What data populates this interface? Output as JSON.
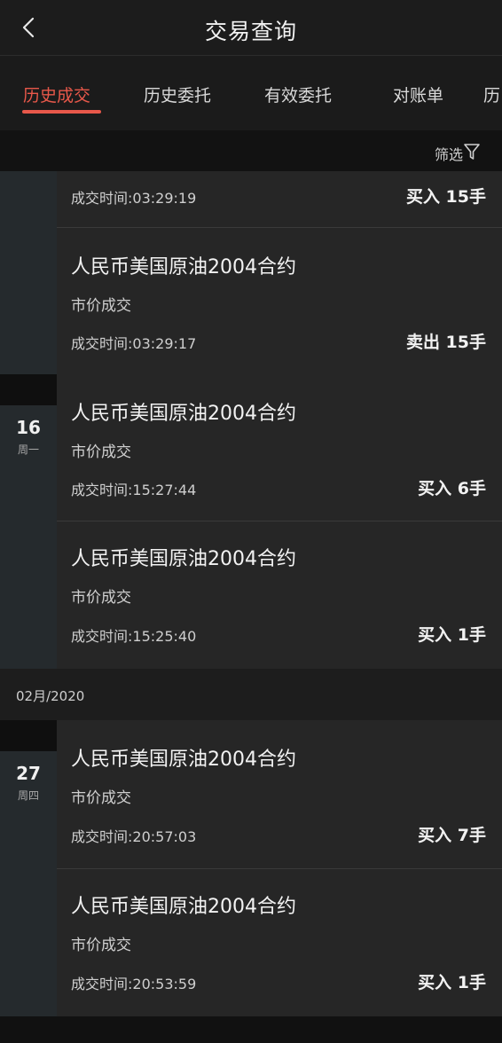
{
  "header": {
    "title": "交易查询"
  },
  "tabs": [
    {
      "label": "历史成交",
      "active": true
    },
    {
      "label": "历史委托"
    },
    {
      "label": "有效委托"
    },
    {
      "label": "对账单"
    },
    {
      "label": "历"
    }
  ],
  "filter": {
    "label": "筛选"
  },
  "groups": [
    {
      "day": "16",
      "weekday": "周一"
    },
    {
      "day": "27",
      "weekday": "周四"
    }
  ],
  "month_label": "02月/2020",
  "trades": [
    {
      "time": "成交时间:03:29:19",
      "action": "买入 15手"
    },
    {
      "name": "人民币美国原油2004合约",
      "price_type": "市价成交",
      "time": "成交时间:03:29:17",
      "action": "卖出 15手"
    },
    {
      "name": "人民币美国原油2004合约",
      "price_type": "市价成交",
      "time": "成交时间:15:27:44",
      "action": "买入 6手"
    },
    {
      "name": "人民币美国原油2004合约",
      "price_type": "市价成交",
      "time": "成交时间:15:25:40",
      "action": "买入 1手"
    },
    {
      "name": "人民币美国原油2004合约",
      "price_type": "市价成交",
      "time": "成交时间:20:57:03",
      "action": "买入 7手"
    },
    {
      "name": "人民币美国原油2004合约",
      "price_type": "市价成交",
      "time": "成交时间:20:53:59",
      "action": "买入 1手"
    }
  ],
  "colors": {
    "accent": "#e8584a",
    "background": "#191919",
    "row": "#262626",
    "date_column": "#252a2d"
  }
}
